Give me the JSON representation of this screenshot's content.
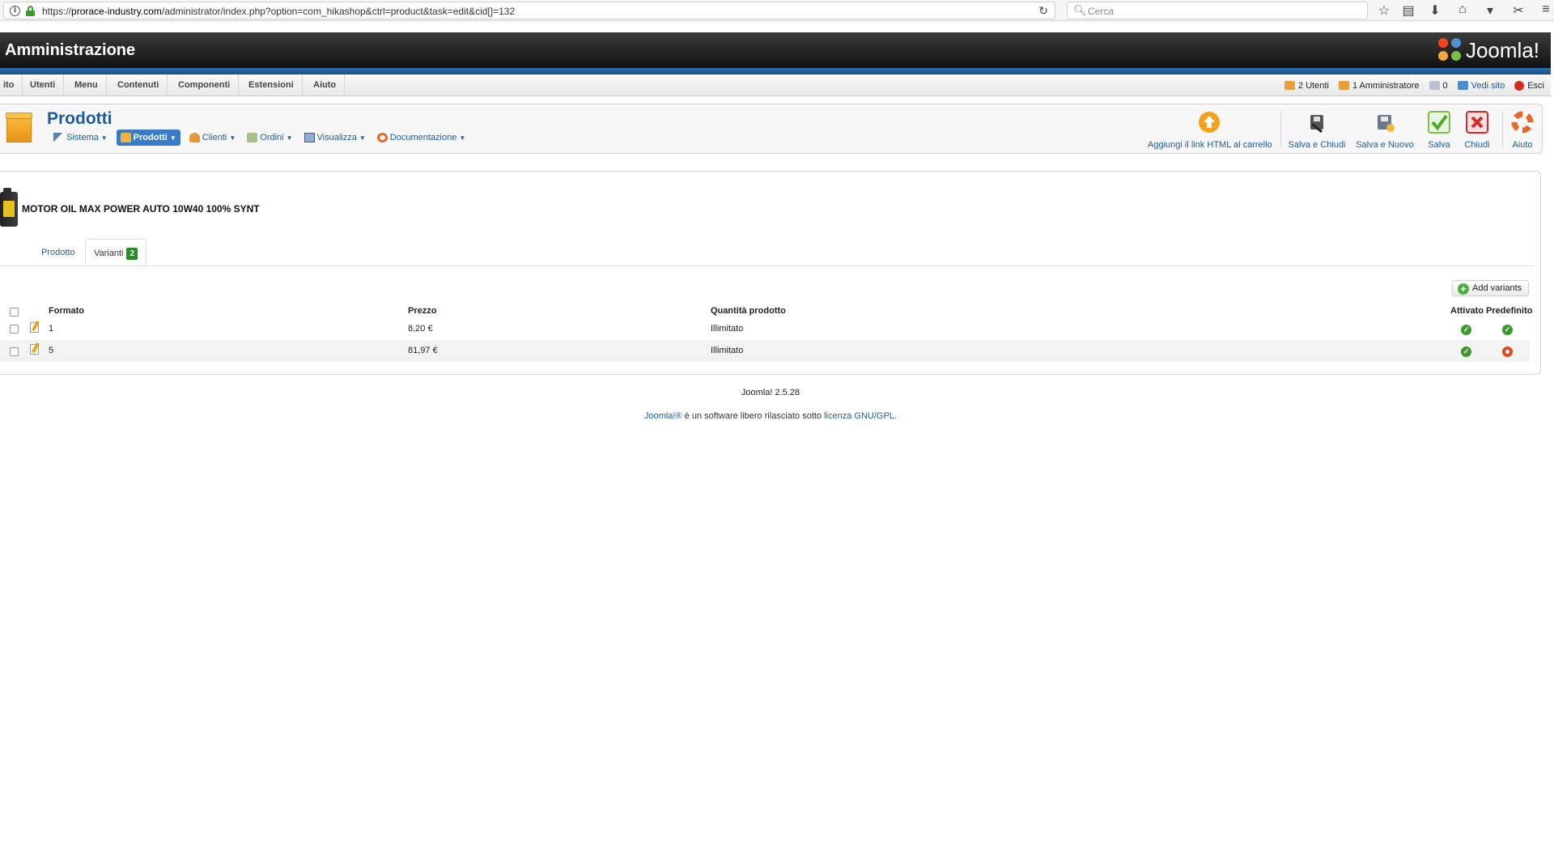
{
  "browser": {
    "url_prefix": "https://",
    "url_host": "prorace-industry.com",
    "url_path": "/administrator/index.php?option=com_hikashop&ctrl=product&task=edit&cid[]=132",
    "search_placeholder": "Cerca"
  },
  "header": {
    "title": "Amministrazione",
    "logo_text": "Joomla!"
  },
  "menu": {
    "items": [
      "ito",
      "Utenti",
      "Menu",
      "Contenuti",
      "Componenti",
      "Estensioni",
      "Aiuto"
    ],
    "status": {
      "users": "2 Utenti",
      "admins": "1 Amministratore",
      "messages": "0",
      "view_site": "Vedi sito",
      "logout": "Esci"
    }
  },
  "toolbar": {
    "page_title": "Prodotti",
    "submenu": [
      "Sistema",
      "Prodotti",
      "Clienti",
      "Ordini",
      "Visualizza",
      "Documentazione"
    ],
    "buttons": {
      "add_link": "Aggiungi il link HTML al carrello",
      "save_close": "Salva e Chiudi",
      "save_new": "Salva e Nuovo",
      "save": "Salva",
      "close": "Chiudi",
      "help": "Aiuto"
    }
  },
  "product": {
    "name": "MOTOR OIL MAX POWER AUTO 10W40 100% SYNT",
    "tabs": {
      "product": "Prodotto",
      "variants": "Varianti",
      "variants_count": "2"
    },
    "add_variants": "Add variants",
    "table": {
      "headers": {
        "format": "Formato",
        "price": "Prezzo",
        "quantity": "Quantità prodotto",
        "enabled": "Attivato",
        "default": "Predefinito"
      },
      "rows": [
        {
          "format": "1",
          "price": "8,20 €",
          "quantity": "Illimitato",
          "enabled": true,
          "default": true
        },
        {
          "format": "5",
          "price": "81,97 €",
          "quantity": "Illimitato",
          "enabled": true,
          "default": false
        }
      ]
    }
  },
  "footer": {
    "version": "Joomla! 2.5.28",
    "license_brand": "Joomla!®",
    "license_text": " è un software libero rilasciato sotto ",
    "license_link": "licenza GNU/GPL."
  },
  "colors": {
    "accent": "#1b5c9e",
    "header_dark": "#111111",
    "stripe_blue": "#2b6eb0",
    "ok_green": "#3a9a2a",
    "no_red": "#d64a1c"
  }
}
